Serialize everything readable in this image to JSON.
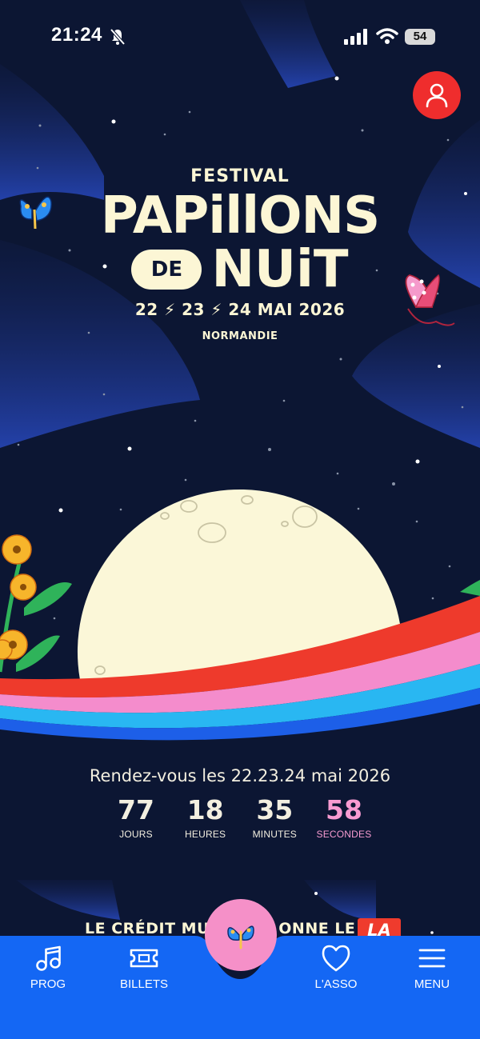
{
  "status_bar": {
    "time": "21:24",
    "battery": "54",
    "icons": [
      "bell-muted-icon",
      "signal-icon",
      "wifi-icon",
      "battery-icon"
    ]
  },
  "header": {
    "profile_icon": "user-icon",
    "accent_color": "#ef2d2d"
  },
  "hero": {
    "festival": "FESTIVAL",
    "title_line1": "PAPillONS",
    "title_de": "DE",
    "title_line2": "NUiT",
    "dates": "22 ⚡ 23 ⚡ 24 MAI 2026",
    "region": "NORMANDIE"
  },
  "countdown": {
    "intro": "Rendez-vous les 22.23.24 mai 2026",
    "units": [
      {
        "value": "77",
        "label": "JOURS"
      },
      {
        "value": "18",
        "label": "HEURES"
      },
      {
        "value": "35",
        "label": "MINUTES"
      },
      {
        "value": "58",
        "label": "SECONDES"
      }
    ]
  },
  "promo": {
    "text": "LE CRÉDIT MU",
    "text_tail": "ONNE LE",
    "badge": "LA"
  },
  "nav": {
    "items": [
      {
        "label": "PROG",
        "icon": "music-note-icon"
      },
      {
        "label": "BILLETS",
        "icon": "ticket-icon"
      },
      {
        "label": "L'ASSO",
        "icon": "heart-icon"
      },
      {
        "label": "MENU",
        "icon": "hamburger-menu-icon"
      }
    ],
    "center_icon": "butterfly-icon",
    "bar_color": "#1467f4",
    "center_color": "#f590c8"
  }
}
